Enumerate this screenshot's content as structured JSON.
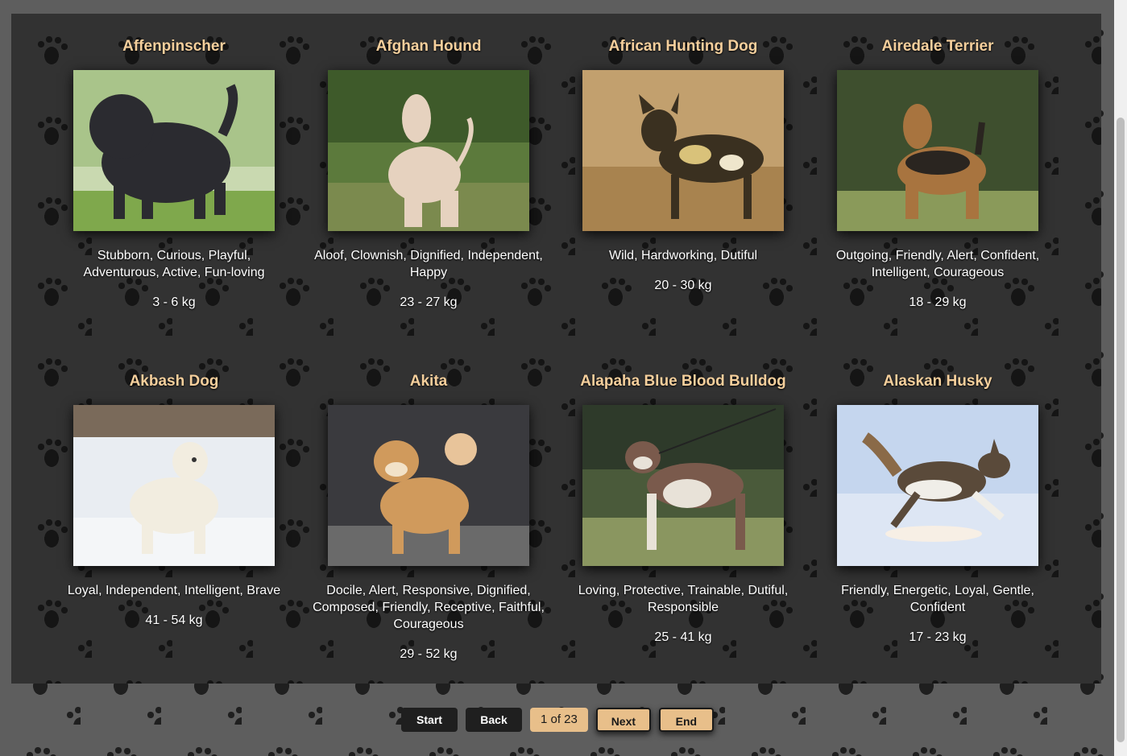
{
  "breeds": [
    {
      "name": "Affenpinscher",
      "temperament": "Stubborn, Curious, Playful, Adventurous, Active, Fun-loving",
      "weight": "3 - 6 kg",
      "image": "black shaggy dog on grass",
      "colors": {
        "bg": "#8fb36a",
        "dog": "#2b2b30"
      }
    },
    {
      "name": "Afghan Hound",
      "temperament": "Aloof, Clownish, Dignified, Independent, Happy",
      "weight": "23 - 27 kg",
      "image": "cream long-haired hound in meadow",
      "colors": {
        "bg": "#5c7a3c",
        "dog": "#e6d2bf"
      }
    },
    {
      "name": "African Hunting Dog",
      "temperament": "Wild, Hardworking, Dutiful",
      "weight": "20 - 30 kg",
      "image": "spotted wild dog in dry grass",
      "colors": {
        "bg": "#c2a06e",
        "dog": "#3a3020"
      }
    },
    {
      "name": "Airedale Terrier",
      "temperament": "Outgoing, Friendly, Alert, Confident, Intelligent, Courageous",
      "weight": "18 - 29 kg",
      "image": "tan terrier in front of ivy",
      "colors": {
        "bg": "#3e4f2e",
        "dog": "#a8743f"
      }
    },
    {
      "name": "Akbash Dog",
      "temperament": "Loyal, Independent, Intelligent, Brave",
      "weight": "41 - 54 kg",
      "image": "white dog in snow",
      "colors": {
        "bg": "#dfe5ec",
        "dog": "#f2ede0"
      }
    },
    {
      "name": "Akita",
      "temperament": "Docile, Alert, Responsive, Dignified, Composed, Friendly, Receptive, Faithful, Courageous",
      "weight": "29 - 52 kg",
      "image": "red akita on pavement",
      "colors": {
        "bg": "#3a3a3e",
        "dog": "#d09a5c"
      }
    },
    {
      "name": "Alapaha Blue Blood Bulldog",
      "temperament": "Loving, Protective, Trainable, Dutiful, Responsible",
      "weight": "25 - 41 kg",
      "image": "brown and white bulldog on leash",
      "colors": {
        "bg": "#6e7a45",
        "dog": "#7a5a4c"
      }
    },
    {
      "name": "Alaskan Husky",
      "temperament": "Friendly, Energetic, Loyal, Gentle, Confident",
      "weight": "17 - 23 kg",
      "image": "husky running on snow",
      "colors": {
        "bg": "#c5d6ee",
        "dog": "#5a4a3a"
      }
    }
  ],
  "pagination": {
    "start_label": "Start",
    "back_label": "Back",
    "counter": "1 of 23",
    "next_label": "Next",
    "end_label": "End"
  }
}
